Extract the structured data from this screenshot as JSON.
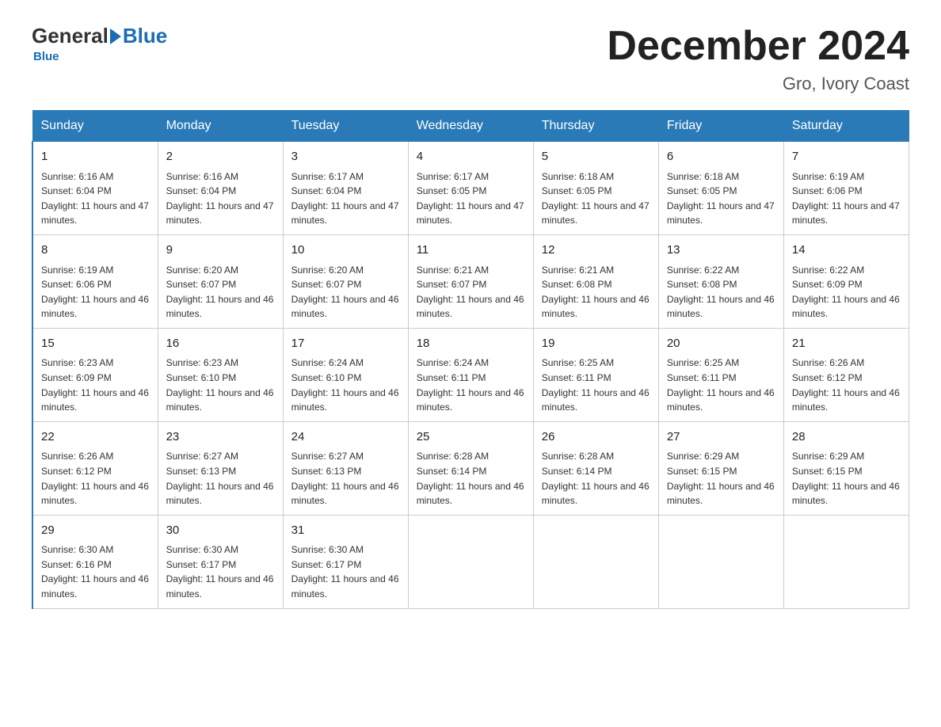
{
  "header": {
    "logo_general": "General",
    "logo_blue": "Blue",
    "month_title": "December 2024",
    "location": "Gro, Ivory Coast"
  },
  "weekdays": [
    "Sunday",
    "Monday",
    "Tuesday",
    "Wednesday",
    "Thursday",
    "Friday",
    "Saturday"
  ],
  "weeks": [
    [
      {
        "day": "1",
        "sunrise": "6:16 AM",
        "sunset": "6:04 PM",
        "daylight": "11 hours and 47 minutes."
      },
      {
        "day": "2",
        "sunrise": "6:16 AM",
        "sunset": "6:04 PM",
        "daylight": "11 hours and 47 minutes."
      },
      {
        "day": "3",
        "sunrise": "6:17 AM",
        "sunset": "6:04 PM",
        "daylight": "11 hours and 47 minutes."
      },
      {
        "day": "4",
        "sunrise": "6:17 AM",
        "sunset": "6:05 PM",
        "daylight": "11 hours and 47 minutes."
      },
      {
        "day": "5",
        "sunrise": "6:18 AM",
        "sunset": "6:05 PM",
        "daylight": "11 hours and 47 minutes."
      },
      {
        "day": "6",
        "sunrise": "6:18 AM",
        "sunset": "6:05 PM",
        "daylight": "11 hours and 47 minutes."
      },
      {
        "day": "7",
        "sunrise": "6:19 AM",
        "sunset": "6:06 PM",
        "daylight": "11 hours and 47 minutes."
      }
    ],
    [
      {
        "day": "8",
        "sunrise": "6:19 AM",
        "sunset": "6:06 PM",
        "daylight": "11 hours and 46 minutes."
      },
      {
        "day": "9",
        "sunrise": "6:20 AM",
        "sunset": "6:07 PM",
        "daylight": "11 hours and 46 minutes."
      },
      {
        "day": "10",
        "sunrise": "6:20 AM",
        "sunset": "6:07 PM",
        "daylight": "11 hours and 46 minutes."
      },
      {
        "day": "11",
        "sunrise": "6:21 AM",
        "sunset": "6:07 PM",
        "daylight": "11 hours and 46 minutes."
      },
      {
        "day": "12",
        "sunrise": "6:21 AM",
        "sunset": "6:08 PM",
        "daylight": "11 hours and 46 minutes."
      },
      {
        "day": "13",
        "sunrise": "6:22 AM",
        "sunset": "6:08 PM",
        "daylight": "11 hours and 46 minutes."
      },
      {
        "day": "14",
        "sunrise": "6:22 AM",
        "sunset": "6:09 PM",
        "daylight": "11 hours and 46 minutes."
      }
    ],
    [
      {
        "day": "15",
        "sunrise": "6:23 AM",
        "sunset": "6:09 PM",
        "daylight": "11 hours and 46 minutes."
      },
      {
        "day": "16",
        "sunrise": "6:23 AM",
        "sunset": "6:10 PM",
        "daylight": "11 hours and 46 minutes."
      },
      {
        "day": "17",
        "sunrise": "6:24 AM",
        "sunset": "6:10 PM",
        "daylight": "11 hours and 46 minutes."
      },
      {
        "day": "18",
        "sunrise": "6:24 AM",
        "sunset": "6:11 PM",
        "daylight": "11 hours and 46 minutes."
      },
      {
        "day": "19",
        "sunrise": "6:25 AM",
        "sunset": "6:11 PM",
        "daylight": "11 hours and 46 minutes."
      },
      {
        "day": "20",
        "sunrise": "6:25 AM",
        "sunset": "6:11 PM",
        "daylight": "11 hours and 46 minutes."
      },
      {
        "day": "21",
        "sunrise": "6:26 AM",
        "sunset": "6:12 PM",
        "daylight": "11 hours and 46 minutes."
      }
    ],
    [
      {
        "day": "22",
        "sunrise": "6:26 AM",
        "sunset": "6:12 PM",
        "daylight": "11 hours and 46 minutes."
      },
      {
        "day": "23",
        "sunrise": "6:27 AM",
        "sunset": "6:13 PM",
        "daylight": "11 hours and 46 minutes."
      },
      {
        "day": "24",
        "sunrise": "6:27 AM",
        "sunset": "6:13 PM",
        "daylight": "11 hours and 46 minutes."
      },
      {
        "day": "25",
        "sunrise": "6:28 AM",
        "sunset": "6:14 PM",
        "daylight": "11 hours and 46 minutes."
      },
      {
        "day": "26",
        "sunrise": "6:28 AM",
        "sunset": "6:14 PM",
        "daylight": "11 hours and 46 minutes."
      },
      {
        "day": "27",
        "sunrise": "6:29 AM",
        "sunset": "6:15 PM",
        "daylight": "11 hours and 46 minutes."
      },
      {
        "day": "28",
        "sunrise": "6:29 AM",
        "sunset": "6:15 PM",
        "daylight": "11 hours and 46 minutes."
      }
    ],
    [
      {
        "day": "29",
        "sunrise": "6:30 AM",
        "sunset": "6:16 PM",
        "daylight": "11 hours and 46 minutes."
      },
      {
        "day": "30",
        "sunrise": "6:30 AM",
        "sunset": "6:17 PM",
        "daylight": "11 hours and 46 minutes."
      },
      {
        "day": "31",
        "sunrise": "6:30 AM",
        "sunset": "6:17 PM",
        "daylight": "11 hours and 46 minutes."
      },
      null,
      null,
      null,
      null
    ]
  ]
}
